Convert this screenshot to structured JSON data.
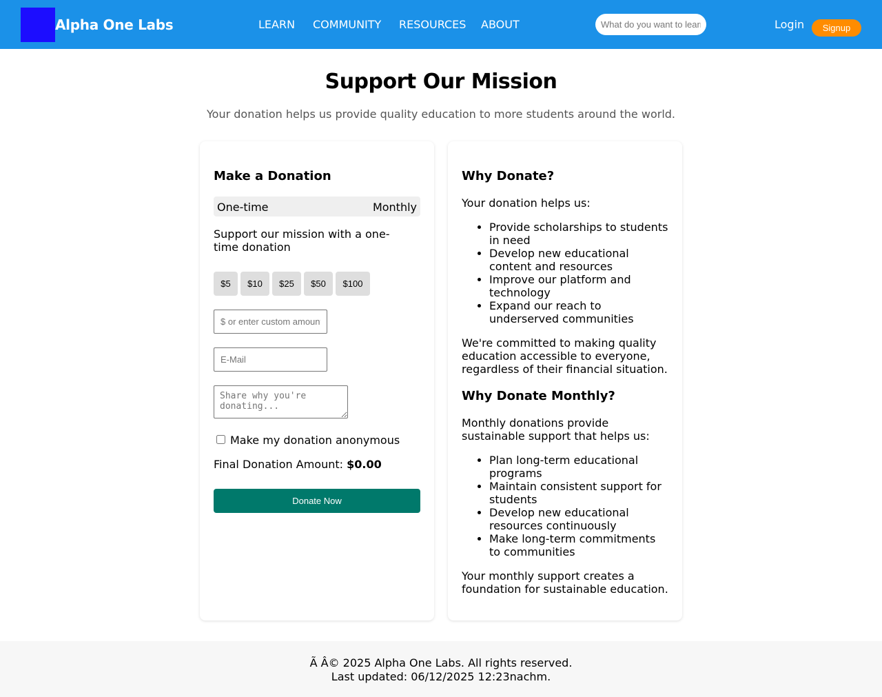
{
  "header": {
    "brand": "Alpha One Labs",
    "logo_color": "#1c0dff",
    "bg_color": "#1b91e8",
    "nav": [
      "LEARN",
      "COMMUNITY",
      "RESOURCES",
      "ABOUT"
    ],
    "search_placeholder": "What do you want to learn?",
    "login": "Login",
    "signup": "Signup"
  },
  "page": {
    "title": "Support Our Mission",
    "subtitle": "Your donation helps us provide quality education to more students around the world."
  },
  "donation": {
    "heading": "Make a Donation",
    "toggle": [
      "One-time",
      "Monthly"
    ],
    "description": "Support our mission with a one-time donation",
    "amounts": [
      "$5",
      "$10",
      "$25",
      "$50",
      "$100"
    ],
    "custom_placeholder": "$ or enter custom amount",
    "email_placeholder": "E-Mail",
    "message_placeholder": "Share why you're donating...",
    "anonymous_label": "Make my donation anonymous",
    "final_label": "Final Donation Amount:",
    "final_value": "$0.00",
    "donate_button": "Donate Now",
    "button_color": "#00796b"
  },
  "why": {
    "heading": "Why Donate?",
    "intro": "Your donation helps us:",
    "items": [
      "Provide scholarships to students in need",
      "Develop new educational content and resources",
      "Improve our platform and technology",
      "Expand our reach to underserved communities"
    ],
    "closing": "We're committed to making quality education accessible to everyone, regardless of their financial situation.",
    "monthly_heading": "Why Donate Monthly?",
    "monthly_intro": "Monthly donations provide sustainable support that helps us:",
    "monthly_items": [
      "Plan long-term educational programs",
      "Maintain consistent support for students",
      "Develop new educational resources continuously",
      "Make long-term commitments to communities"
    ],
    "monthly_closing": "Your monthly support creates a foundation for sustainable education."
  },
  "footer": {
    "copyright": "Ã   Â© 2025 Alpha One Labs. All rights reserved.",
    "updated": "Last updated: 06/12/2025 12:23nachm."
  }
}
